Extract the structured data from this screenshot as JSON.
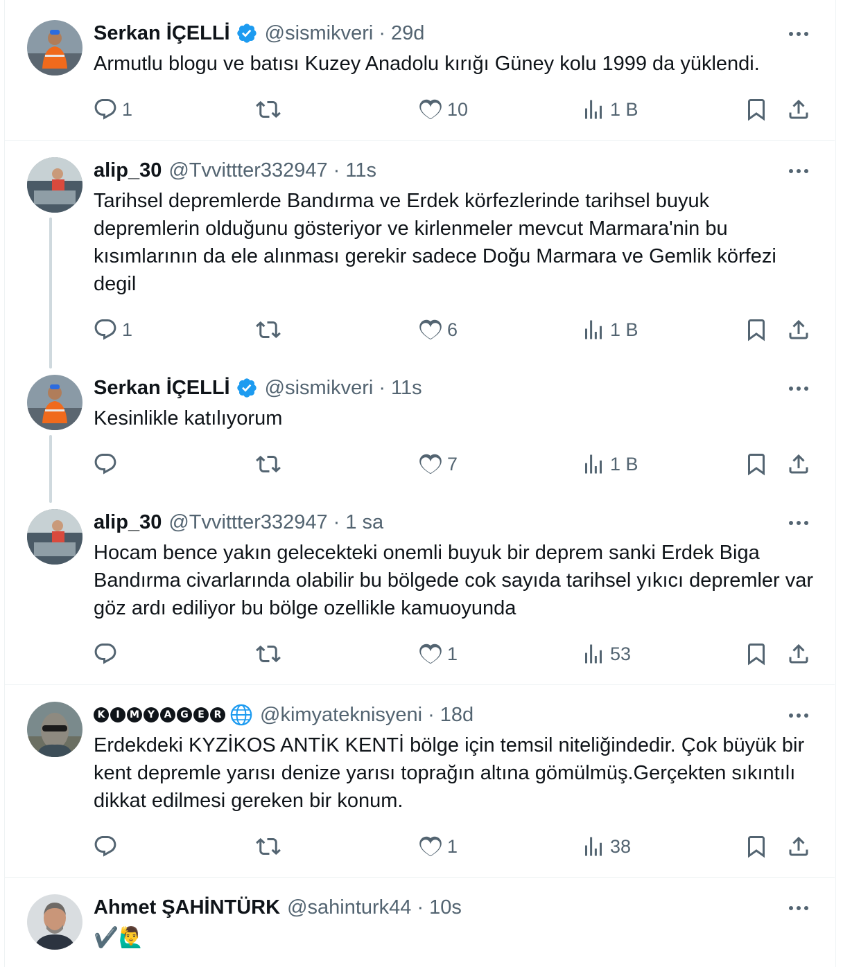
{
  "colors": {
    "text": "#0f1419",
    "muted": "#536471",
    "verified": "#1d9bf0",
    "border": "#eff3f4",
    "thread": "#cfd9de"
  },
  "tweets": [
    {
      "name": "Serkan İÇELLİ",
      "verified": true,
      "handle": "@sismikveri",
      "time": "29d",
      "text": "Armutlu blogu ve batısı Kuzey Anadolu kırığı Güney kolu 1999 da yüklendi.",
      "replies": "1",
      "retweets": "",
      "likes": "10",
      "views": "1 B"
    },
    {
      "name": "alip_30",
      "verified": false,
      "handle": "@Tvvittter332947",
      "time": "11s",
      "text": "Tarihsel depremlerde Bandırma ve Erdek körfezlerinde tarihsel buyuk depremlerin olduğunu gösteriyor ve kirlenmeler mevcut Marmara'nin bu kısımlarının da ele alınması gerekir sadece Doğu Marmara ve Gemlik körfezi degil",
      "replies": "1",
      "retweets": "",
      "likes": "6",
      "views": "1 B"
    },
    {
      "name": "Serkan İÇELLİ",
      "verified": true,
      "handle": "@sismikveri",
      "time": "11s",
      "text": "Kesinlikle katılıyorum",
      "replies": "",
      "retweets": "",
      "likes": "7",
      "views": "1 B"
    },
    {
      "name": "alip_30",
      "verified": false,
      "handle": "@Tvvittter332947",
      "time": "1 sa",
      "text": "Hocam bence yakın gelecekteki onemli buyuk bir deprem sanki Erdek Biga Bandırma civarlarında olabilir bu bölgede cok sayıda tarihsel yıkıcı depremler var göz ardı ediliyor bu bölge ozellikle kamuoyunda",
      "replies": "",
      "retweets": "",
      "likes": "1",
      "views": "53"
    },
    {
      "name_letters": [
        "K",
        "I",
        "M",
        "Y",
        "A",
        "G",
        "E",
        "R"
      ],
      "verified": false,
      "handle": "@kimyateknisyeni",
      "time": "18d",
      "text": "Erdekdeki KYZİKOS ANTİK KENTİ bölge için temsil niteliğindedir. Çok büyük bir kent depremle yarısı denize yarısı toprağın altına gömülmüş.Gerçekten sıkıntılı dikkat edilmesi gereken bir konum.",
      "replies": "",
      "retweets": "",
      "likes": "1",
      "views": "38"
    },
    {
      "name": "Ahmet ŞAHİNTÜRK",
      "verified": false,
      "handle": "@sahinturk44",
      "time": "10s",
      "text": "✔️🙋‍♂️"
    }
  ],
  "separator": "·",
  "icons": {
    "reply": "reply-icon",
    "retweet": "retweet-icon",
    "like": "heart-icon",
    "views": "views-icon",
    "bookmark": "bookmark-icon",
    "share": "share-icon",
    "more": "more-icon",
    "verified": "verified-badge-icon",
    "globe": "globe-icon"
  }
}
